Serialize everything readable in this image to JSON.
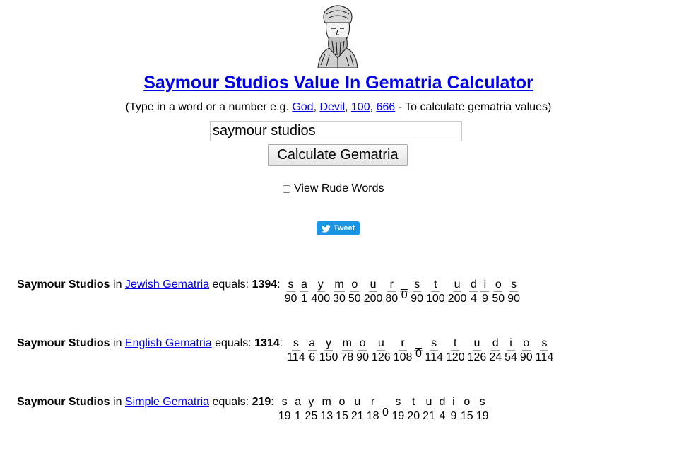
{
  "title": "Saymour Studios Value In Gematria Calculator",
  "subtitle": {
    "prefix": "(Type in a word or a number e.g. ",
    "links": [
      "God",
      "Devil",
      "100",
      "666"
    ],
    "sep": ", ",
    "suffix": " - To calculate gematria values)"
  },
  "search": {
    "value": "saymour studios"
  },
  "calculate_label": "Calculate Gematria",
  "rude_label": "View Rude Words",
  "tweet_label": "Tweet",
  "phrase": "Saymour Studios",
  "in_word": " in ",
  "equals_word": " equals: ",
  "results": [
    {
      "system": "Jewish Gematria",
      "total": "1394",
      "letters": [
        "s",
        "a",
        "y",
        "m",
        "o",
        "u",
        "r",
        "_",
        "s",
        "t",
        "u",
        "d",
        "i",
        "o",
        "s"
      ],
      "values": [
        "90",
        "1",
        "400",
        "30",
        "50",
        "200",
        "80",
        "0",
        "90",
        "100",
        "200",
        "4",
        "9",
        "50",
        "90"
      ]
    },
    {
      "system": "English Gematria",
      "total": "1314",
      "letters": [
        "s",
        "a",
        "y",
        "m",
        "o",
        "u",
        "r",
        "_",
        "s",
        "t",
        "u",
        "d",
        "i",
        "o",
        "s"
      ],
      "values": [
        "114",
        "6",
        "150",
        "78",
        "90",
        "126",
        "108",
        "0",
        "114",
        "120",
        "126",
        "24",
        "54",
        "90",
        "114"
      ]
    },
    {
      "system": "Simple Gematria",
      "total": "219",
      "letters": [
        "s",
        "a",
        "y",
        "m",
        "o",
        "u",
        "r",
        "_",
        "s",
        "t",
        "u",
        "d",
        "i",
        "o",
        "s"
      ],
      "values": [
        "19",
        "1",
        "25",
        "13",
        "15",
        "21",
        "18",
        "0",
        "19",
        "20",
        "21",
        "4",
        "9",
        "15",
        "19"
      ]
    }
  ]
}
